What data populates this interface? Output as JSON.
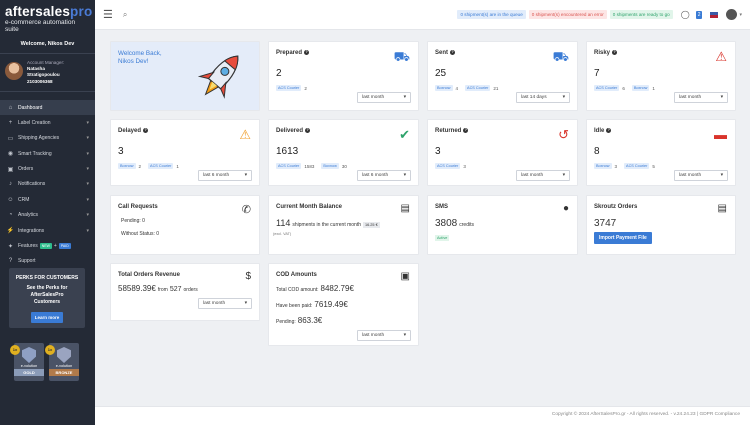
{
  "brand": {
    "logo_main": "aftersales",
    "logo_pro": "pro",
    "tagline": "e-commerce automation suite"
  },
  "sidebar": {
    "welcome": "Welcome, Nikos Dev",
    "manager": {
      "label": "Account Manager:",
      "name1": "Natasha",
      "name2": "Stratigopoulou",
      "phone": "2103006368"
    },
    "items": [
      {
        "label": "Dashboard",
        "icon": "home-icon",
        "glyph": "⌂",
        "chevron": false,
        "active": true
      },
      {
        "label": "Label Creation",
        "icon": "plus-icon",
        "glyph": "+",
        "chevron": true
      },
      {
        "label": "Shipping Agencies",
        "icon": "truck-icon",
        "glyph": "▭",
        "chevron": true
      },
      {
        "label": "Smart Tracking",
        "icon": "map-pin-icon",
        "glyph": "◉",
        "chevron": true
      },
      {
        "label": "Orders",
        "icon": "box-icon",
        "glyph": "▣",
        "chevron": true
      },
      {
        "label": "Notifications",
        "icon": "bell-icon",
        "glyph": "♪",
        "chevron": true
      },
      {
        "label": "CRM",
        "icon": "users-icon",
        "glyph": "☺",
        "chevron": true
      },
      {
        "label": "Analytics",
        "icon": "chart-icon",
        "glyph": "◔",
        "chevron": true
      },
      {
        "label": "Integrations",
        "icon": "plug-icon",
        "glyph": "⚡",
        "chevron": true
      },
      {
        "label": "Features",
        "icon": "star-icon",
        "glyph": "✦",
        "chevron": false,
        "badge_new": "NEW",
        "badge_paid": "PAID",
        "plus": "+"
      },
      {
        "label": "Support",
        "icon": "help-icon",
        "glyph": "?",
        "chevron": false
      }
    ],
    "perks": {
      "title": "PERKS FOR CUSTOMERS",
      "desc1": "See the Perks for",
      "desc2": "AfterSalesPro",
      "desc3": "Customers",
      "button": "Learn more"
    },
    "awards": [
      {
        "x": "1x",
        "name": "e-volution",
        "level": "GOLD"
      },
      {
        "x": "1x",
        "name": "e-volution",
        "level": "BRONZE"
      }
    ]
  },
  "topbar": {
    "queue": "0 shipment(s) are in the queue",
    "error": "0 shipment(s) encountered an error",
    "ready": "0 shipments are ready to go",
    "chat_badge": "2"
  },
  "cards": {
    "welcome": {
      "line1": "Welcome Back,",
      "line2": "Nikos Dev!"
    },
    "prepared": {
      "title": "Prepared",
      "value": "2",
      "tags": [
        {
          "name": "ACS Courier",
          "count": "2"
        }
      ],
      "select": "last month"
    },
    "sent": {
      "title": "Sent",
      "value": "25",
      "tags": [
        {
          "name": "Boxnow",
          "count": "4"
        },
        {
          "name": "ACS Courier",
          "count": "21"
        }
      ],
      "select": "last 14 days"
    },
    "risky": {
      "title": "Risky",
      "value": "7",
      "tags": [
        {
          "name": "ACS Courier",
          "count": "6"
        },
        {
          "name": "Boxnow",
          "count": "1"
        }
      ],
      "select": "last month"
    },
    "delayed": {
      "title": "Delayed",
      "value": "3",
      "tags": [
        {
          "name": "Boxnow",
          "count": "2"
        },
        {
          "name": "ACS Courier",
          "count": "1"
        }
      ],
      "select": "last 6 month"
    },
    "delivered": {
      "title": "Delivered",
      "value": "1613",
      "tags": [
        {
          "name": "ACS Courier",
          "count": "1583"
        },
        {
          "name": "Boxnow",
          "count": "30"
        }
      ],
      "select": "last 6 month"
    },
    "returned": {
      "title": "Returned",
      "value": "3",
      "tags": [
        {
          "name": "ACS Courier",
          "count": "3"
        }
      ],
      "select": "last month"
    },
    "idle": {
      "title": "Idle",
      "value": "8",
      "tags": [
        {
          "name": "Boxnow",
          "count": "3"
        },
        {
          "name": "ACS Courier",
          "count": "5"
        }
      ],
      "select": "last month"
    },
    "calls": {
      "title": "Call Requests",
      "pending": "Pending: 0",
      "without": "Without Status: 0"
    },
    "balance": {
      "title": "Current Month Balance",
      "value": "114",
      "text": "shipments in the current month",
      "amount": "16.25 €",
      "vat": "(excl. VAT)"
    },
    "sms": {
      "title": "SMS",
      "value": "3808",
      "unit": "credits",
      "status": "Active"
    },
    "skroutz": {
      "title": "Skroutz Orders",
      "value": "3747",
      "button": "Import Payment File"
    },
    "revenue": {
      "title": "Total Orders Revenue",
      "value": "58589.39€",
      "from": "from",
      "count": "527",
      "unit": "orders",
      "select": "last month"
    },
    "cod": {
      "title": "COD Amounts",
      "total_lbl": "Total COD amount:",
      "total": "8482.79€",
      "paid_lbl": "Have been paid:",
      "paid": "7619.49€",
      "pending_lbl": "Pending:",
      "pending": "863.3€",
      "select": "last month"
    }
  },
  "footer": "Copyright © 2024 AfterSalesPro.gr - All rights reserved. - v.24.24.23 | GDPR Compliance"
}
